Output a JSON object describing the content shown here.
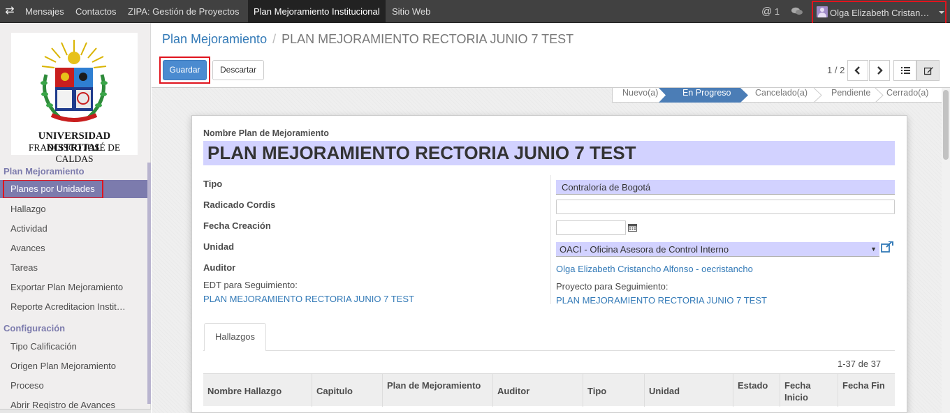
{
  "topbar": {
    "menu": [
      {
        "label": "Mensajes"
      },
      {
        "label": "Contactos"
      },
      {
        "label": "ZIPA: Gestión de Proyectos"
      },
      {
        "label": "Plan Mejoramiento Institucional"
      },
      {
        "label": "Sitio Web"
      }
    ],
    "mention_count": "1",
    "user_name": "Olga Elizabeth Cristancho Alfonso"
  },
  "logo": {
    "line1": "UNIVERSIDAD DISTRITAL",
    "line2": "FRANCISCO JOSÉ DE CALDAS"
  },
  "sidebar": {
    "section1": "Plan Mejoramiento",
    "items1": [
      {
        "label": "Planes por Unidades"
      },
      {
        "label": "Hallazgo"
      },
      {
        "label": "Actividad"
      },
      {
        "label": "Avances"
      },
      {
        "label": "Tareas"
      },
      {
        "label": "Exportar Plan Mejoramiento"
      },
      {
        "label": "Reporte Acreditacion Institucional"
      }
    ],
    "section2": "Configuración",
    "items2": [
      {
        "label": "Tipo Calificación"
      },
      {
        "label": "Origen Plan Mejoramiento"
      },
      {
        "label": "Proceso"
      },
      {
        "label": "Abrir Registro de Avances"
      }
    ]
  },
  "breadcrumb": {
    "parent": "Plan Mejoramiento",
    "separator": "/",
    "current": "PLAN MEJORAMIENTO RECTORIA JUNIO 7 TEST"
  },
  "buttons": {
    "save": "Guardar",
    "discard": "Descartar"
  },
  "pager": {
    "value": "1 / 2"
  },
  "statusbar": [
    "Nuevo(a)",
    "En Progreso",
    "Cancelado(a)",
    "Pendiente",
    "Cerrado(a)"
  ],
  "form": {
    "name_label": "Nombre Plan de Mejoramiento",
    "name_value": "PLAN MEJORAMIENTO RECTORIA JUNIO 7 TEST",
    "tipo_label": "Tipo",
    "tipo_value": "Contraloría de Bogotá",
    "radicado_label": "Radicado Cordis",
    "radicado_value": "",
    "fecha_label": "Fecha Creación",
    "fecha_value": "",
    "unidad_label": "Unidad",
    "unidad_value": "OACI - Oficina Asesora de Control Interno",
    "auditor_label": "Auditor",
    "auditor_value": "Olga Elizabeth Cristancho Alfonso - oecristancho",
    "edt_label": "EDT para Seguimiento:",
    "edt_value": "PLAN MEJORAMIENTO RECTORIA JUNIO 7 TEST",
    "proyecto_label": "Proyecto para Seguimiento:",
    "proyecto_value": "PLAN MEJORAMIENTO RECTORIA JUNIO 7 TEST"
  },
  "tabs": {
    "hallazgos": "Hallazgos"
  },
  "table": {
    "count": "1-37 de 37",
    "columns": [
      "Nombre Hallazgo",
      "Capitulo",
      "Plan de Mejoramiento",
      "Auditor",
      "Tipo",
      "Unidad",
      "Estado",
      "Fecha Inicio",
      "Fecha Fin"
    ]
  },
  "colors": {
    "accent": "#7c7bad",
    "primary": "#4b8bd0",
    "link": "#337ab7",
    "required_field": "#d2d2ff",
    "highlight": "#e0141e"
  }
}
